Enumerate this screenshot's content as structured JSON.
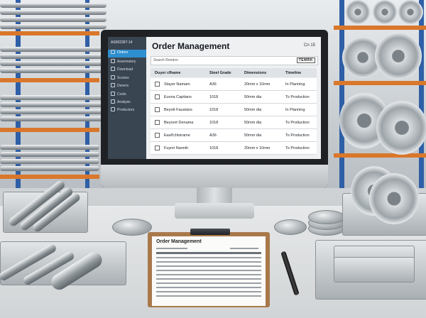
{
  "app": {
    "account_id": "AS002397-14",
    "title": "Order Management",
    "corner_label": "Cn 15",
    "logo_text": "TEMRK",
    "search": {
      "placeholder": "Search Rendon"
    }
  },
  "sidebar": {
    "items": [
      {
        "label": "Orders",
        "active": true
      },
      {
        "label": "Assematory",
        "active": false
      },
      {
        "label": "Download",
        "active": false
      },
      {
        "label": "Scones",
        "active": false
      },
      {
        "label": "Deners",
        "active": false
      },
      {
        "label": "Costs",
        "active": false
      },
      {
        "label": "Analysis",
        "active": false
      },
      {
        "label": "Productors",
        "active": false
      }
    ]
  },
  "table": {
    "columns": [
      "Duyer cfhame",
      "Steel Grade",
      "Dimensions",
      "Timeline"
    ],
    "rows": [
      [
        "Stayer Namam",
        "A36",
        "20mm x 10mm",
        "In Planning"
      ],
      [
        "Euvna Captians",
        "1018",
        "50mm dia",
        "To Production"
      ],
      [
        "Beyott Faustans",
        "1018",
        "50mm dia",
        "In Planning"
      ],
      [
        "Beyoort Denama",
        "1018",
        "50mm dia",
        "To Production"
      ],
      [
        "Easlt'chlsirame",
        "A36",
        "50mm dia",
        "To Production"
      ],
      [
        "Fuynri Nannih",
        "1018",
        "20mm x 10mm",
        "To Production"
      ]
    ]
  },
  "clipboard": {
    "title": "Order Management"
  },
  "colors": {
    "sidebar_bg": "#3a4552",
    "active_nav": "#2e8fd0",
    "rack_blue": "#2f5fa6",
    "rack_orange": "#d9772b"
  }
}
